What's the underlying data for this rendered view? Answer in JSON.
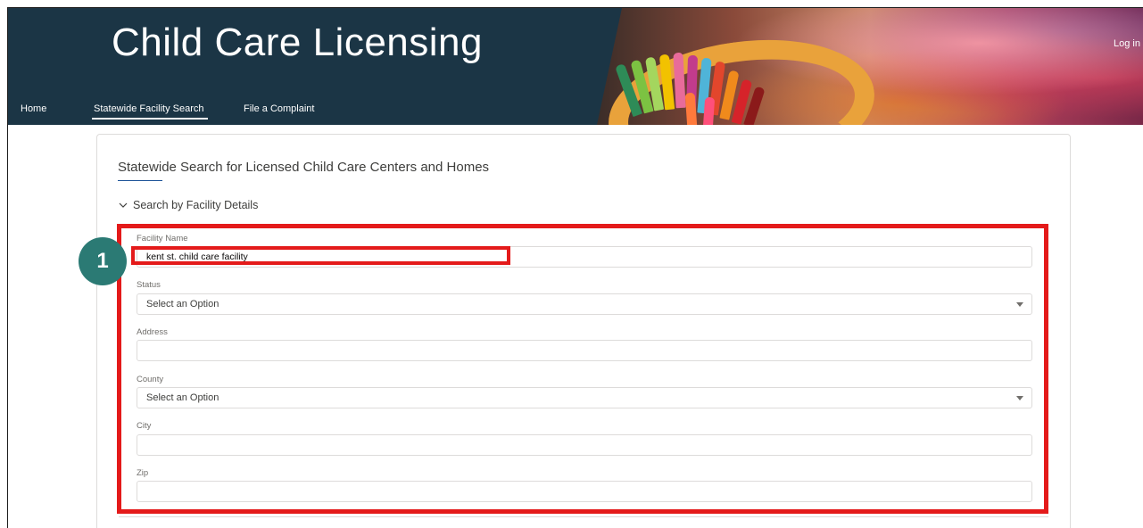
{
  "header": {
    "title": "Child Care Licensing",
    "login_label": "Log in",
    "nav": [
      {
        "label": "Home"
      },
      {
        "label": "Statewide Facility Search"
      },
      {
        "label": "File a Complaint"
      }
    ],
    "active_nav": "Statewide Facility Search"
  },
  "card": {
    "title": "Statewide Search for Licensed Child Care Centers and Homes",
    "section_label": "Search by Facility Details"
  },
  "form": {
    "facility_name": {
      "label": "Facility Name",
      "value": "kent st. child care facility"
    },
    "status": {
      "label": "Status",
      "value": "Select an Option"
    },
    "address": {
      "label": "Address",
      "value": ""
    },
    "county": {
      "label": "County",
      "value": "Select an Option"
    },
    "city": {
      "label": "City",
      "value": ""
    },
    "zip": {
      "label": "Zip",
      "value": ""
    }
  },
  "annotation": {
    "step_number": "1",
    "highlight_color": "#e41a1a",
    "badge_color": "#2b7a74"
  },
  "colors": {
    "header_bg": "#1b3545",
    "accent": "#1b5297"
  }
}
